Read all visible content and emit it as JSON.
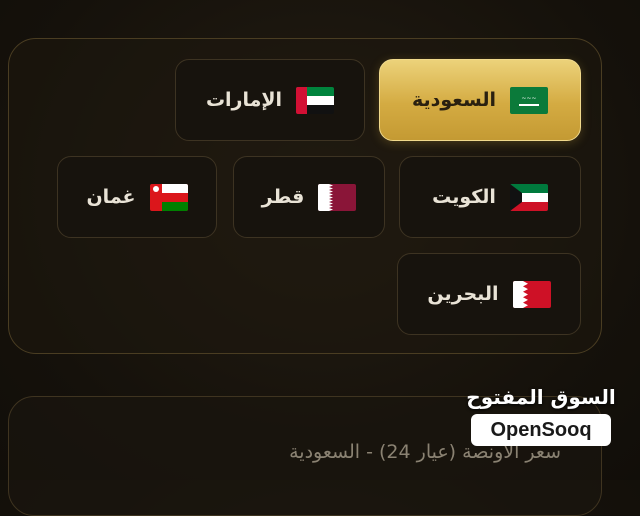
{
  "countries": [
    {
      "label": "السعودية",
      "flag": "saudi-flag-icon",
      "active": true
    },
    {
      "label": "الإمارات",
      "flag": "uae-flag-icon",
      "active": false
    },
    {
      "label": "الكويت",
      "flag": "kuwait-flag-icon",
      "active": false
    },
    {
      "label": "قطر",
      "flag": "qatar-flag-icon",
      "active": false
    },
    {
      "label": "غمان",
      "flag": "oman-flag-icon",
      "active": false
    },
    {
      "label": "البحرين",
      "flag": "bahrain-flag-icon",
      "active": false
    }
  ],
  "price_card": {
    "title": "سعر الاونصة (عيار 24) - السعودية"
  },
  "watermark": {
    "arabic": "السوق المفتوح",
    "english": "OpenSooq"
  },
  "colors": {
    "accent_gold": "#d4ab42",
    "background": "#15110b"
  }
}
